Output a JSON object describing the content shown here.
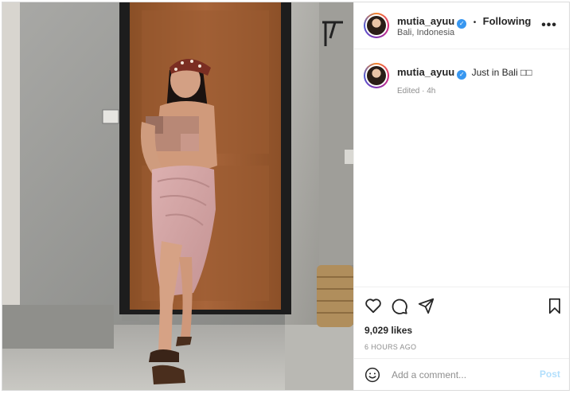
{
  "post": {
    "username": "mutia_ayuu",
    "location": "Bali, Indonesia",
    "follow_status": "Following",
    "separator": "•",
    "more_label": "•••",
    "caption": "Just in Bali □□",
    "edited": "Edited · 4h",
    "likes": "9,029 likes",
    "timestamp": "6 HOURS AGO"
  },
  "comment": {
    "placeholder": "Add a comment...",
    "post_label": "Post"
  },
  "icons": {
    "verified": "verified-badge-icon",
    "like": "heart-icon",
    "comment": "comment-icon",
    "share": "share-icon",
    "save": "bookmark-icon",
    "emoji": "emoji-icon",
    "more": "more-options-icon"
  },
  "colors": {
    "verified_blue": "#3897f0",
    "post_disabled": "#b2dffc",
    "muted_text": "#8e8e8e"
  }
}
